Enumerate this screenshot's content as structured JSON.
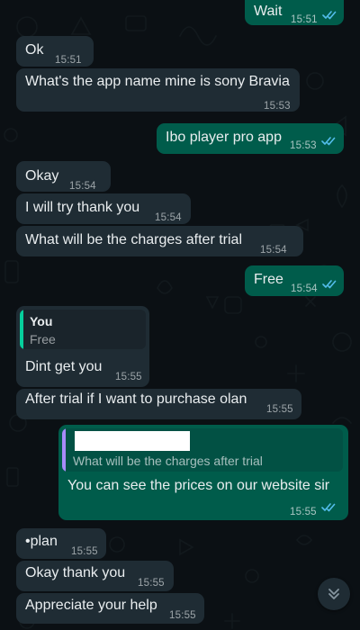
{
  "messages": [
    {
      "id": "m1",
      "dir": "out",
      "text": "Wait",
      "time": "15:51",
      "read": true
    },
    {
      "id": "m2",
      "dir": "in",
      "text": "Ok",
      "time": "15:51"
    },
    {
      "id": "m3",
      "dir": "in",
      "text": "What's the app name mine is sony Bravia",
      "time": "15:53"
    },
    {
      "id": "m4",
      "dir": "out",
      "text": "Ibo player pro app",
      "time": "15:53",
      "read": true
    },
    {
      "id": "m5",
      "dir": "in",
      "text": "Okay",
      "time": "15:54"
    },
    {
      "id": "m6",
      "dir": "in",
      "text": "I will try thank you",
      "time": "15:54"
    },
    {
      "id": "m7",
      "dir": "in",
      "text": "What will be the charges after trial",
      "time": "15:54"
    },
    {
      "id": "m8",
      "dir": "out",
      "text": "Free",
      "time": "15:54",
      "read": true
    },
    {
      "id": "m9",
      "dir": "in",
      "quote_author": "You",
      "quote_text": "Free",
      "text": "Dint get you",
      "time": "15:55"
    },
    {
      "id": "m10",
      "dir": "in",
      "text": "After trial if I want to purchase olan",
      "time": "15:55"
    },
    {
      "id": "m11",
      "dir": "out",
      "quote_text": "What will be the charges after trial",
      "text": "You can see the prices on our website sir",
      "time": "15:55",
      "read": true
    },
    {
      "id": "m12",
      "dir": "in",
      "text": "•plan",
      "time": "15:55"
    },
    {
      "id": "m13",
      "dir": "in",
      "text": "Okay thank you",
      "time": "15:55"
    },
    {
      "id": "m14",
      "dir": "in",
      "text": "Appreciate your help",
      "time": "15:55"
    }
  ],
  "colors": {
    "background": "#0b1014",
    "incoming_bubble": "#1f2c34",
    "outgoing_bubble": "#005c4b",
    "read_ticks": "#53bdeb",
    "quote_own_bar": "#06cf9c",
    "quote_other_bar": "#a78bfa"
  },
  "icons": {
    "read_receipt": "double-check-icon",
    "scroll_down": "chevron-double-down-icon"
  }
}
